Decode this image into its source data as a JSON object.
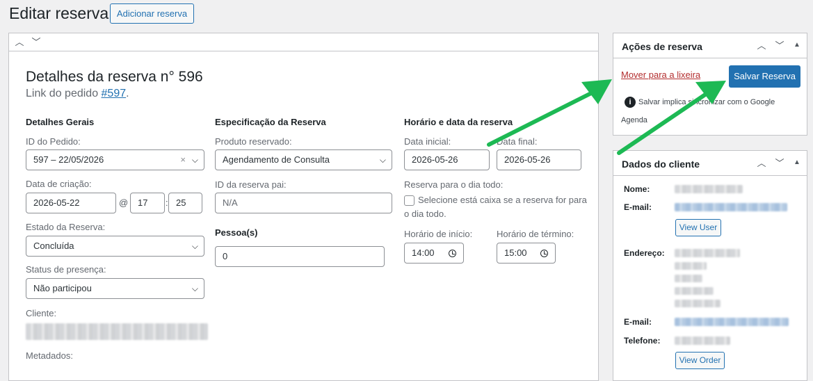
{
  "page": {
    "title": "Editar reserva",
    "add_button": "Adicionar reserva"
  },
  "booking": {
    "title": "Detalhes da reserva n° 596",
    "order_link_prefix": "Link do pedido ",
    "order_link": "#597",
    "order_link_suffix": "."
  },
  "general": {
    "heading": "Detalhes Gerais",
    "order_id_label": "ID do Pedido:",
    "order_id_value": "597 – 22/05/2026",
    "created_label": "Data de criação:",
    "created_date": "2026-05-22",
    "at": "@",
    "created_hour": "17",
    "colon": ":",
    "created_min": "25",
    "status_label": "Estado da Reserva:",
    "status_value": "Concluída",
    "presence_label": "Status de presença:",
    "presence_value": "Não participou",
    "client_label": "Cliente:",
    "metadata_label": "Metadados:"
  },
  "spec": {
    "heading": "Especificação da Reserva",
    "product_label": "Produto reservado:",
    "product_value": "Agendamento de Consulta",
    "parent_label": "ID da reserva pai:",
    "parent_placeholder": "N/A",
    "persons_label": "Pessoa(s)",
    "persons_value": "0"
  },
  "schedule": {
    "heading": "Horário e data da reserva",
    "start_label": "Data inicial:",
    "start_value": "2026-05-26",
    "end_label": "Data final:",
    "end_value": "2026-05-26",
    "allday_label": "Reserva para o dia todo:",
    "allday_text_1": "Selecione está caixa se a reserva for para",
    "allday_text_2": "o dia todo.",
    "start_time_label": "Horário de início:",
    "start_time_value": "14:00",
    "end_time_label": "Horário de término:",
    "end_time_value": "15:00"
  },
  "actions": {
    "title": "Ações de reserva",
    "trash": "Mover para a lixeira",
    "save": "Salvar Reserva",
    "note_1": "Salvar implica sincronizar com o Google",
    "note_2": "Agenda"
  },
  "customer": {
    "title": "Dados do cliente",
    "name_label": "Nome:",
    "email_label": "E-mail:",
    "view_user": "View User",
    "address_label": "Endereço:",
    "email2_label": "E-mail:",
    "phone_label": "Telefone:",
    "view_order": "View Order"
  },
  "colors": {
    "accent": "#2271b1",
    "danger": "#b32d2e",
    "annotation_arrow": "#1db954"
  },
  "icons": [
    "chevron-up-icon",
    "chevron-down-icon",
    "triangle-up-icon",
    "clear-icon",
    "clock-icon",
    "info-icon"
  ]
}
